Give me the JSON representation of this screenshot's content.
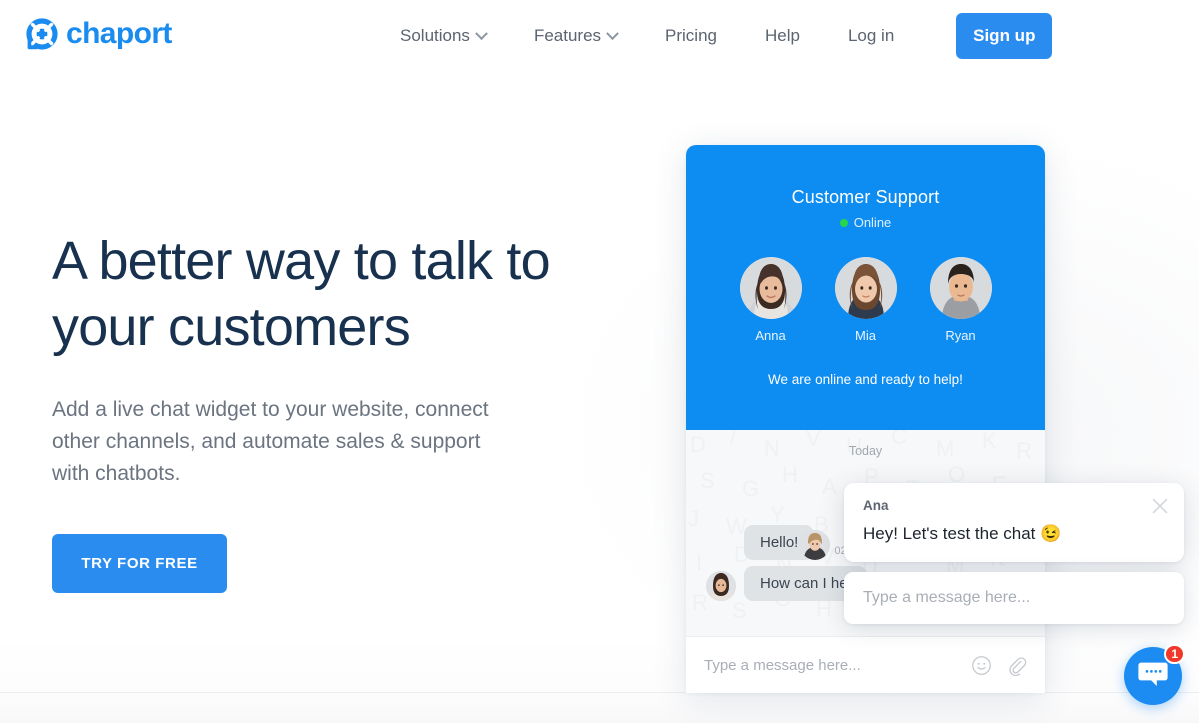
{
  "brand": {
    "name": "chaport",
    "logo_icon": "lifebuoy-icon",
    "accent_color": "#2b8cf0",
    "logo_color": "#1a8cf0"
  },
  "nav": {
    "items": [
      {
        "label": "Solutions",
        "has_dropdown": true
      },
      {
        "label": "Features",
        "has_dropdown": true
      },
      {
        "label": "Pricing",
        "has_dropdown": false
      },
      {
        "label": "Help",
        "has_dropdown": false
      },
      {
        "label": "Log in",
        "has_dropdown": false
      }
    ],
    "signup_label": "Sign up"
  },
  "hero": {
    "heading": "A better way to talk to your customers",
    "subheading": "Add a live chat widget to your website, connect other channels, and automate sales & support with chatbots.",
    "cta_label": "TRY FOR FREE",
    "heading_color": "#17314f",
    "sub_color": "#6b7480"
  },
  "widget": {
    "title": "Customer Support",
    "status": "Online",
    "status_color": "#27d648",
    "header_color": "#0d8cf2",
    "agents": [
      {
        "name": "Anna"
      },
      {
        "name": "Mia"
      },
      {
        "name": "Ryan"
      }
    ],
    "tagline": "We are online and ready to help!",
    "date_divider": "Today",
    "messages": [
      {
        "sender": "agent",
        "text": "Hello!",
        "time": "02",
        "align": "left",
        "has_avatar": true
      },
      {
        "sender": "agent",
        "text": "How can I hel",
        "time": "",
        "align": "left",
        "has_avatar": true
      }
    ],
    "composer_placeholder": "Type a message here...",
    "composer_icons": [
      "emoji-icon",
      "attachment-icon"
    ]
  },
  "popup": {
    "sender": "Ana",
    "message": "Hey! Let's test the chat 😉",
    "close_icon": "close-icon",
    "input_placeholder": "Type a message here..."
  },
  "launcher": {
    "icon": "chat-bubble-icon",
    "badge": "1",
    "badge_color": "#f0392b",
    "bg_color": "#1c8cf2"
  }
}
